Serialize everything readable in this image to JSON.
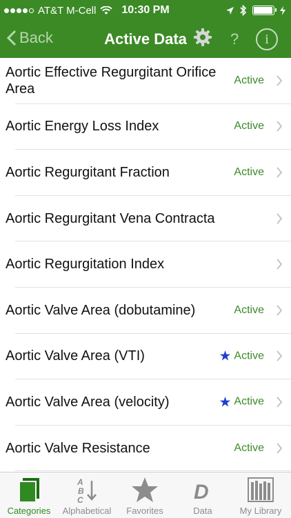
{
  "status_bar": {
    "carrier": "AT&T M-Cell",
    "time": "10:30 PM"
  },
  "nav": {
    "back_label": "Back",
    "title": "Active Data",
    "help_label": "?",
    "info_label": "i"
  },
  "rows": [
    {
      "label": "Aortic Effective Regurgitant Orifice Area",
      "status": "Active",
      "starred": false
    },
    {
      "label": "Aortic Energy Loss Index",
      "status": "Active",
      "starred": false
    },
    {
      "label": "Aortic Regurgitant Fraction",
      "status": "Active",
      "starred": false
    },
    {
      "label": "Aortic Regurgitant Vena Contracta",
      "status": "",
      "starred": false
    },
    {
      "label": "Aortic Regurgitation Index",
      "status": "",
      "starred": false
    },
    {
      "label": "Aortic Valve Area (dobutamine)",
      "status": "Active",
      "starred": false
    },
    {
      "label": "Aortic Valve Area (VTI)",
      "status": "Active",
      "starred": true
    },
    {
      "label": "Aortic Valve Area (velocity)",
      "status": "Active",
      "starred": true
    },
    {
      "label": "Aortic Valve Resistance",
      "status": "Active",
      "starred": false
    }
  ],
  "tabs": [
    {
      "label": "Categories",
      "icon": "categories-icon",
      "active": true
    },
    {
      "label": "Alphabetical",
      "icon": "alphabetical-icon",
      "active": false
    },
    {
      "label": "Favorites",
      "icon": "star-icon",
      "active": false
    },
    {
      "label": "Data",
      "icon": "data-icon",
      "active": false
    },
    {
      "label": "My Library",
      "icon": "library-icon",
      "active": false
    }
  ],
  "colors": {
    "header": "#3b8a26",
    "active_text": "#3a8a28",
    "star": "#1c3fd2",
    "tab_active": "#2f8a22"
  }
}
